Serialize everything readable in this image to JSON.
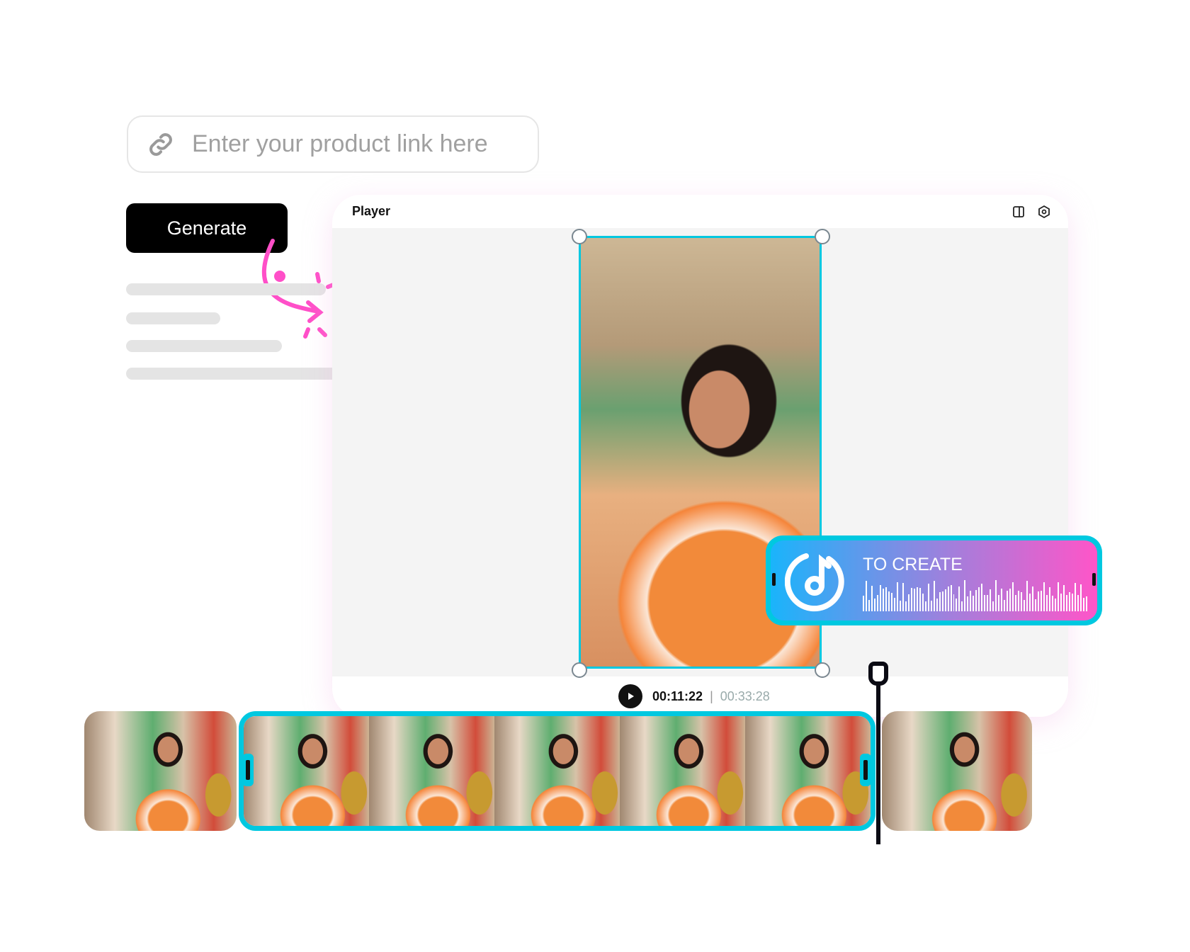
{
  "link_input": {
    "placeholder": "Enter your product link here",
    "icon": "link-icon"
  },
  "generate_button": {
    "label": "Generate"
  },
  "player": {
    "title": "Player",
    "icons": [
      "split-view-icon",
      "settings-hexagon-icon"
    ]
  },
  "audio_clip": {
    "title": "TO CREATE",
    "icon": "music-note-icon"
  },
  "playback": {
    "current_time": "00:11:22",
    "separator": "|",
    "total_time": "00:33:28"
  },
  "colors": {
    "accent": "#00c8e0",
    "annotation": "#ff4fc8",
    "button": "#000000",
    "gradient_start": "#1ab4fb",
    "gradient_end": "#ff55c8"
  }
}
